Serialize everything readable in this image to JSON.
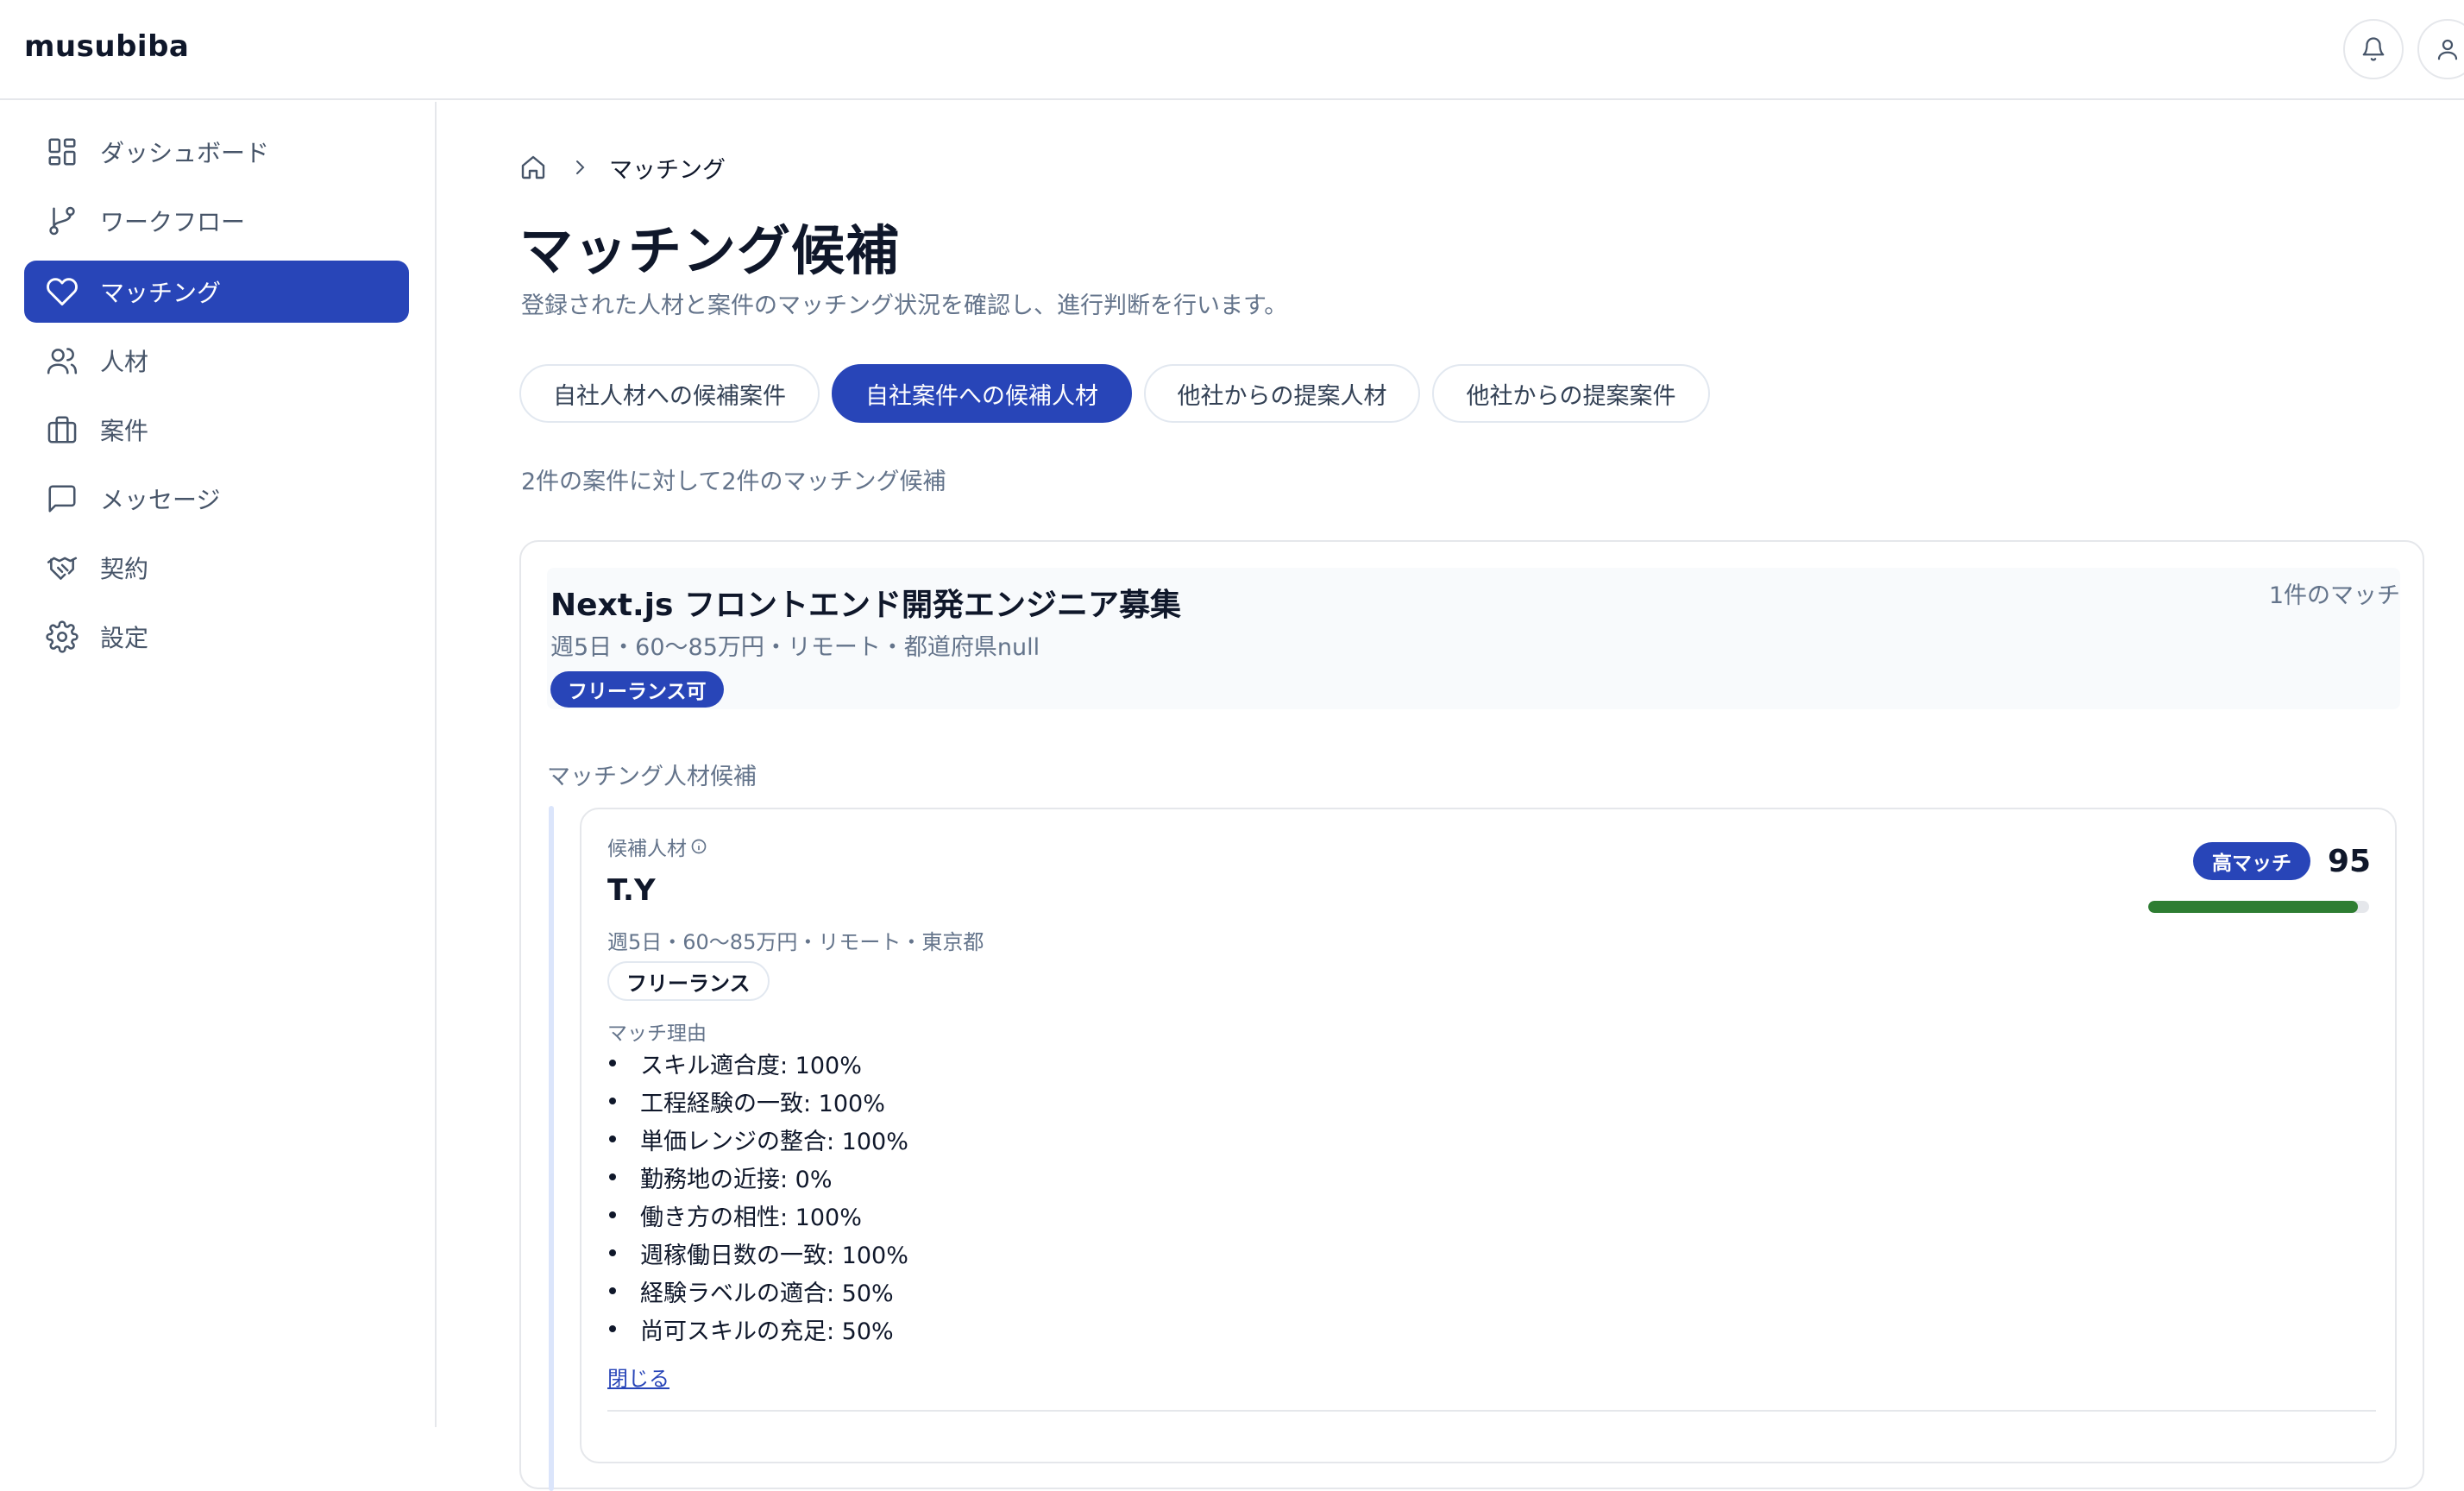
{
  "app": {
    "logo": "musubiba"
  },
  "header": {
    "icons": [
      "bell-icon",
      "user-icon"
    ]
  },
  "sidebar": {
    "items": [
      {
        "label": "ダッシュボード",
        "icon": "dashboard-icon",
        "active": false
      },
      {
        "label": "ワークフロー",
        "icon": "git-branch-icon",
        "active": false
      },
      {
        "label": "マッチング",
        "icon": "heart-icon",
        "active": true
      },
      {
        "label": "人材",
        "icon": "users-icon",
        "active": false
      },
      {
        "label": "案件",
        "icon": "briefcase-icon",
        "active": false
      },
      {
        "label": "メッセージ",
        "icon": "message-icon",
        "active": false
      },
      {
        "label": "契約",
        "icon": "handshake-icon",
        "active": false
      },
      {
        "label": "設定",
        "icon": "gear-icon",
        "active": false
      }
    ]
  },
  "breadcrumb": {
    "home_icon": "home-icon",
    "current": "マッチング"
  },
  "page": {
    "title": "マッチング候補",
    "description": "登録された人材と案件のマッチング状況を確認し、進行判断を行います。"
  },
  "tabs": [
    {
      "label": "自社人材への候補案件",
      "active": false
    },
    {
      "label": "自社案件への候補人材",
      "active": true
    },
    {
      "label": "他社からの提案人材",
      "active": false
    },
    {
      "label": "他社からの提案案件",
      "active": false
    }
  ],
  "summary": "2件の案件に対して2件のマッチング候補",
  "job": {
    "title": "Next.js フロントエンド開発エンジニア募集",
    "meta": "週5日・60〜85万円・リモート・都道府県null",
    "badge": "フリーランス可",
    "match_count": "1件のマッチ",
    "section_label": "マッチング人材候補"
  },
  "candidate": {
    "kicker": "候補人材",
    "name": "T.Y",
    "meta": "週5日・60〜85万円・リモート・東京都",
    "badge": "フリーランス",
    "score_label": "高マッチ",
    "score": "95",
    "score_percent": 95,
    "score_color": "#2e7d32",
    "reason_label": "マッチ理由",
    "reasons": [
      "スキル適合度: 100%",
      "工程経験の一致: 100%",
      "単価レンジの整合: 100%",
      "勤務地の近接: 0%",
      "働き方の相性: 100%",
      "週稼働日数の一致: 100%",
      "経験ラベルの適合: 50%",
      "尚可スキルの充足: 50%"
    ],
    "close_link": "閉じる"
  },
  "colors": {
    "accent": "#2845b8",
    "muted": "#64748b",
    "border": "#e5e7eb"
  }
}
